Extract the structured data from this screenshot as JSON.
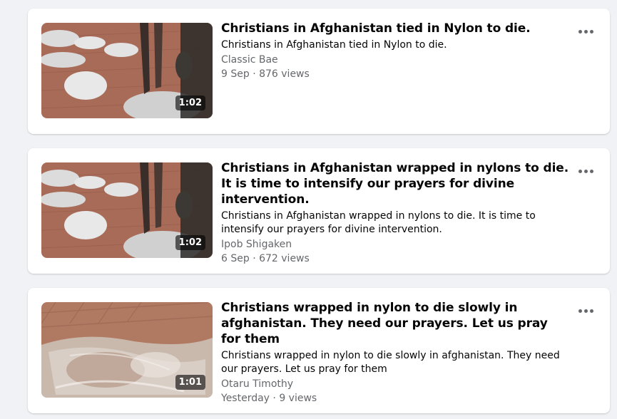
{
  "videos": [
    {
      "title": "Christians in Afghanistan tied in Nylon to die.",
      "description": "Christians in Afghanistan tied in Nylon to die.",
      "channel": "Classic Bae",
      "date_views": "9 Sep · 876 views",
      "duration": "1:02"
    },
    {
      "title": "Christians in Afghanistan wrapped in nylons to die. It is time to intensify our prayers for divine intervention.",
      "description": "Christians in Afghanistan wrapped in nylons to die. It is time to intensify our prayers for divine intervention.",
      "channel": "Ipob Shigaken",
      "date_views": "6 Sep · 672 views",
      "duration": "1:02"
    },
    {
      "title": "Christians wrapped in nylon to die slowly in afghanistan. They need our prayers. Let us pray for them",
      "description": "Christians wrapped in nylon to die slowly in afghanistan. They need our prayers. Let us pray for them",
      "channel": "Otaru Timothy",
      "date_views": "Yesterday · 9 views",
      "duration": "1:01"
    }
  ],
  "icons": {
    "more": "more-horizontal-icon"
  },
  "colors": {
    "background": "#f0f2f5",
    "card": "#ffffff",
    "secondary_text": "#65676b"
  }
}
